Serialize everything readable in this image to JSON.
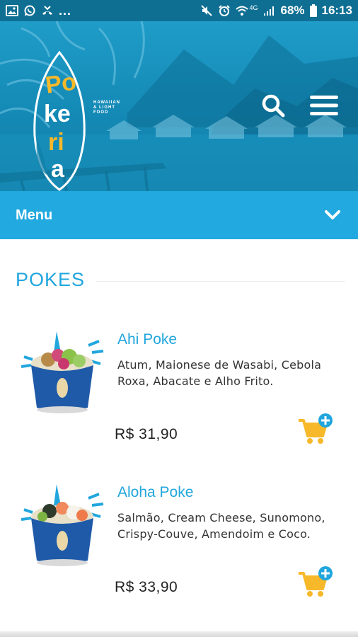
{
  "status_bar": {
    "left_icons": [
      "image-icon",
      "whatsapp-icon",
      "missed-call-icon"
    ],
    "overflow": "...",
    "right_icons": [
      "mute-icon",
      "alarm-icon",
      "wifi-icon",
      "signal-icon",
      "battery-icon"
    ],
    "network": "4G",
    "battery": "68%",
    "time": "16:13"
  },
  "header": {
    "brand_letters": [
      "Po",
      "ke",
      "ri",
      "a"
    ],
    "tagline": [
      "HAWAIIAN",
      "& LIGHT",
      "FOOD"
    ],
    "search_icon": "search-icon",
    "menu_icon": "hamburger-menu-icon"
  },
  "menu_bar": {
    "label": "Menu",
    "icon": "chevron-down-icon"
  },
  "section": {
    "title": "POKES"
  },
  "products": [
    {
      "name": "Ahi Poke",
      "description": "Atum, Maionese de Wasabi, Cebola Roxa, Abacate e Alho Frito.",
      "price": "R$ 31,90",
      "cart_icon": "add-to-cart-icon"
    },
    {
      "name": "Aloha Poke",
      "description": "Salmão, Cream Cheese, Sunomono, Crispy-Couve, Amendoim e Coco.",
      "price": "R$ 33,90",
      "cart_icon": "add-to-cart-icon"
    }
  ],
  "colors": {
    "status_bar": "#0f6f93",
    "hero": "#1489b5",
    "menu_bar": "#22a9df",
    "accent": "#21a6dd",
    "cart": "#f7b82a"
  }
}
